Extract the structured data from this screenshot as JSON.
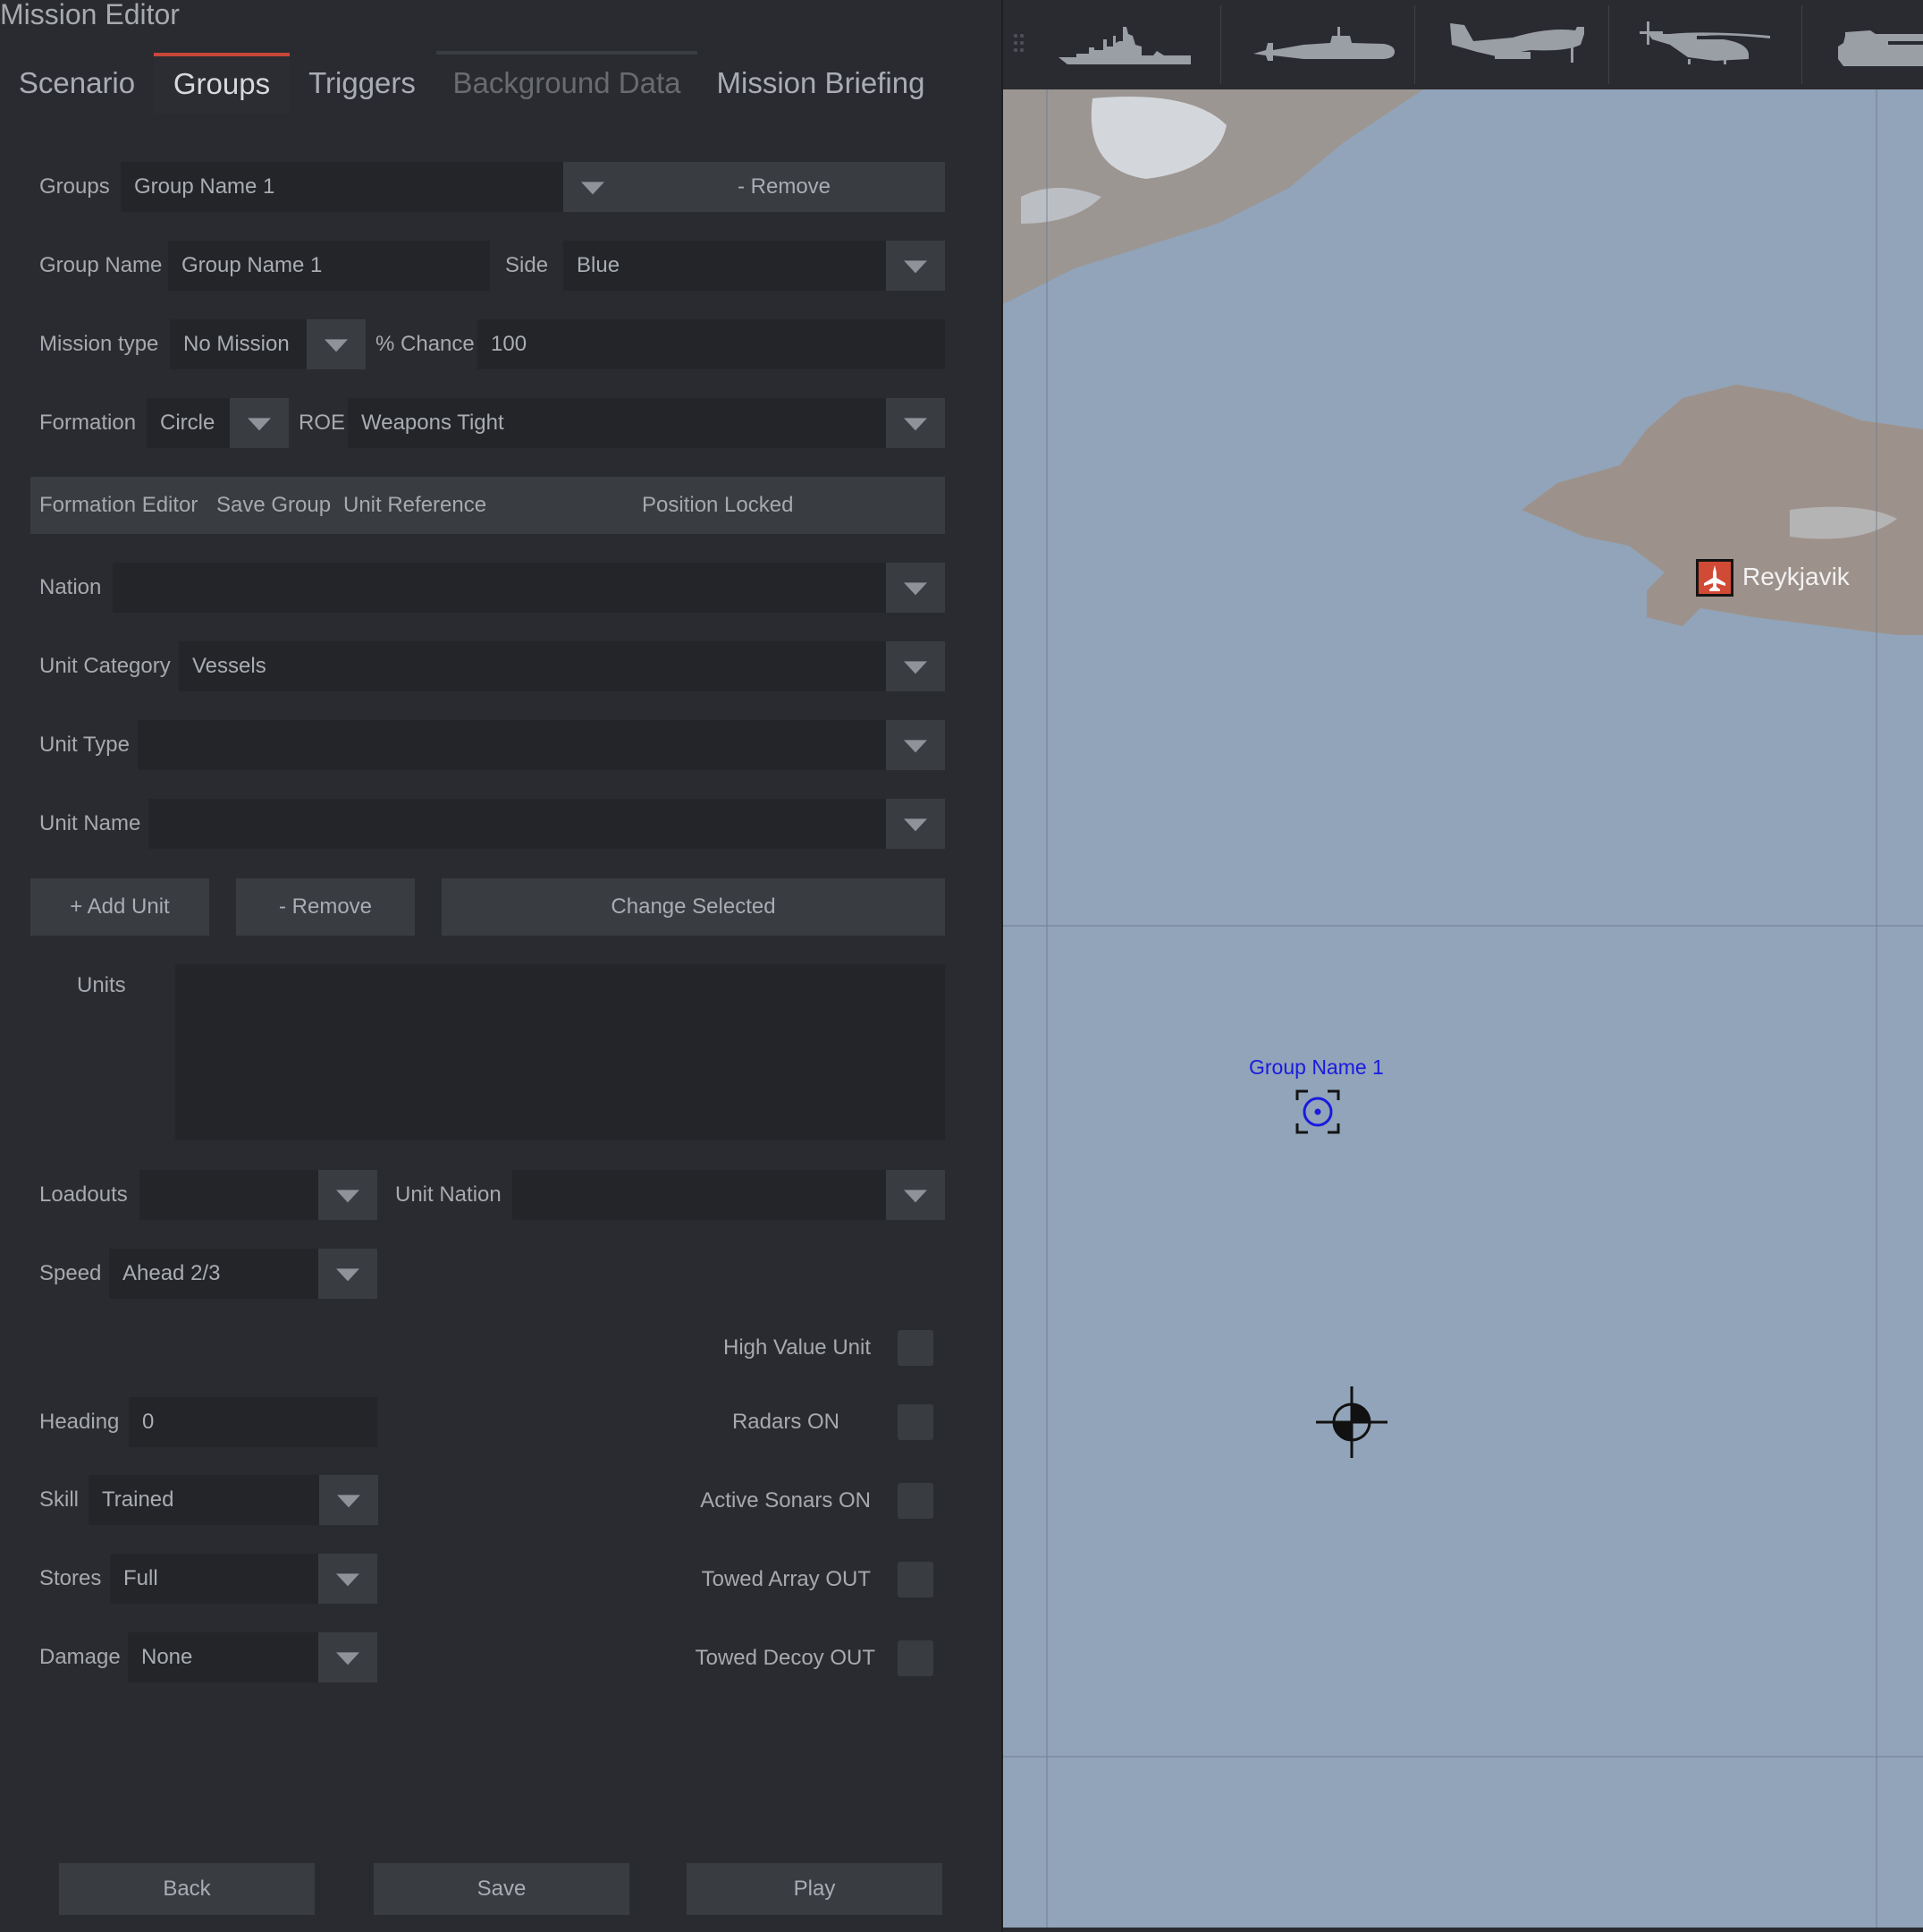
{
  "window": {
    "title": "Mission Editor"
  },
  "tabs": [
    {
      "label": "Scenario",
      "state": "normal"
    },
    {
      "label": "Groups",
      "state": "active"
    },
    {
      "label": "Triggers",
      "state": "normal"
    },
    {
      "label": "Background Data",
      "state": "disabled"
    },
    {
      "label": "Mission Briefing",
      "state": "normal"
    }
  ],
  "colors": {
    "accent": "#c8463a",
    "panel_bg": "#2a2b30",
    "field_bg": "#242529",
    "button_bg": "#393c40",
    "map_sea": "#91a4b9",
    "group_blue": "#1a1ae0",
    "airbase_red": "#d14a36"
  },
  "form": {
    "groups": {
      "label": "Groups",
      "value": "Group Name 1",
      "remove_label": "- Remove"
    },
    "group_name": {
      "label": "Group Name",
      "value": "Group Name 1"
    },
    "side": {
      "label": "Side",
      "value": "Blue"
    },
    "mission_type": {
      "label": "Mission type",
      "value": "No Mission"
    },
    "chance": {
      "label": "% Chance",
      "value": "100"
    },
    "formation": {
      "label": "Formation",
      "value": "Circle"
    },
    "roe": {
      "label": "ROE",
      "value": "Weapons Tight"
    },
    "strip": {
      "formation_editor": "Formation Editor",
      "save_group": "Save Group",
      "unit_reference": "Unit Reference",
      "position_locked": "Position Locked"
    },
    "nation": {
      "label": "Nation",
      "value": ""
    },
    "unit_category": {
      "label": "Unit Category",
      "value": "Vessels"
    },
    "unit_type": {
      "label": "Unit Type",
      "value": ""
    },
    "unit_name": {
      "label": "Unit Name",
      "value": ""
    },
    "unit_buttons": {
      "add": "+ Add Unit",
      "remove": "- Remove",
      "change": "Change Selected"
    },
    "units": {
      "label": "Units",
      "items": []
    },
    "loadouts": {
      "label": "Loadouts",
      "value": ""
    },
    "unit_nation": {
      "label": "Unit Nation",
      "value": ""
    },
    "speed": {
      "label": "Speed",
      "value": "Ahead 2/3"
    },
    "heading": {
      "label": "Heading",
      "value": "0"
    },
    "skill": {
      "label": "Skill",
      "value": "Trained"
    },
    "stores": {
      "label": "Stores",
      "value": "Full"
    },
    "damage": {
      "label": "Damage",
      "value": "None"
    },
    "checkboxes": [
      {
        "label": "High Value Unit",
        "checked": false
      },
      {
        "label": "Radars ON",
        "checked": false
      },
      {
        "label": "Active Sonars ON",
        "checked": false
      },
      {
        "label": "Towed Array OUT",
        "checked": false
      },
      {
        "label": "Towed Decoy OUT",
        "checked": false
      }
    ]
  },
  "footer": {
    "back": "Back",
    "save": "Save",
    "play": "Play"
  },
  "toolbar": {
    "tools": [
      {
        "icon": "ship-icon",
        "name": "Vessels"
      },
      {
        "icon": "submarine-icon",
        "name": "Submarines"
      },
      {
        "icon": "aircraft-icon",
        "name": "Aircraft"
      },
      {
        "icon": "helicopter-icon",
        "name": "Helicopters"
      },
      {
        "icon": "tank-icon",
        "name": "Land units"
      }
    ]
  },
  "map": {
    "airbase": {
      "name": "Reykjavik",
      "icon": "airbase-icon"
    },
    "group_marker": {
      "label": "Group Name 1",
      "icon": "surface-group-icon"
    },
    "reference_marker": {
      "icon": "crosshair-reference-icon"
    }
  }
}
